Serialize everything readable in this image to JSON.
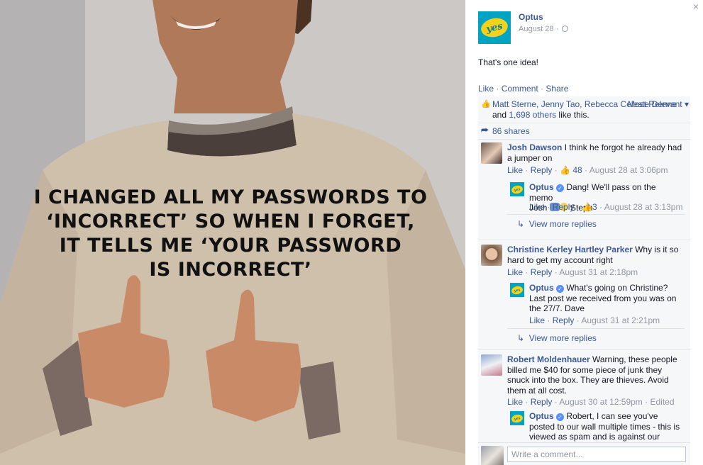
{
  "photo": {
    "meme_lines": [
      "I changed all my passwords to",
      "‘incorrect’ so when I forget,",
      "it tells me ‘your password",
      "is incorrect’"
    ]
  },
  "post": {
    "page_name": "Optus",
    "logo_text": "yes",
    "date": "August 28 ·",
    "text": "That's one idea!",
    "actions": {
      "like": "Like",
      "comment": "Comment",
      "share": "Share"
    },
    "likes": {
      "names": "Matt Sterne, Jenny Tao, Rebecca Celeste Denne",
      "and": " and ",
      "others": "1,698 others",
      "suffix": " like this.",
      "sort": "Most Relevant ▾"
    },
    "shares": "86 shares"
  },
  "comments": [
    {
      "name": "Josh Dawson",
      "text": " I think he forgot he already had a jumper on",
      "like": "Like",
      "reply": "Reply",
      "likes_count": "48",
      "time": "August 28 at 3:06pm",
      "reply_item": {
        "name": "Optus",
        "text_1": " Dang! We'll pass on the memo",
        "text_2": "Josh",
        "text_3": "Steph",
        "like": "Like",
        "reply": "Reply",
        "likes_count": "3",
        "time": "August 28 at 3:13pm"
      },
      "view_more": "View more replies"
    },
    {
      "name": "Christine Kerley Hartley Parker",
      "text": " Why is it so hard to get my account right",
      "like": "Like",
      "reply": "Reply",
      "time": "August 31 at 2:18pm",
      "reply_item": {
        "name": "Optus",
        "text": " What's going on Christine? Last post we received from you was on the 27/7. Dave",
        "like": "Like",
        "reply": "Reply",
        "time": "August 31 at 2:21pm"
      },
      "view_more": "View more replies"
    },
    {
      "name": "Robert Moldenhauer",
      "text": " Warning, these people billed me $40 for some piece of junk they snuck into the box. They are thieves. Avoid them at all cost.",
      "like": "Like",
      "reply": "Reply",
      "time": "August 30 at 12:59pm",
      "edited": "Edited",
      "reply_item": {
        "name": "Optus",
        "text": " Robert, I can see you've posted to our wall multiple times - this is viewed as spam and is against our"
      }
    }
  ],
  "composer": {
    "placeholder": "Write a comment..."
  },
  "close": "×",
  "colors": {
    "link": "#3b5998",
    "optus_teal": "#00a4c3",
    "optus_yellow": "#f4d21c"
  }
}
